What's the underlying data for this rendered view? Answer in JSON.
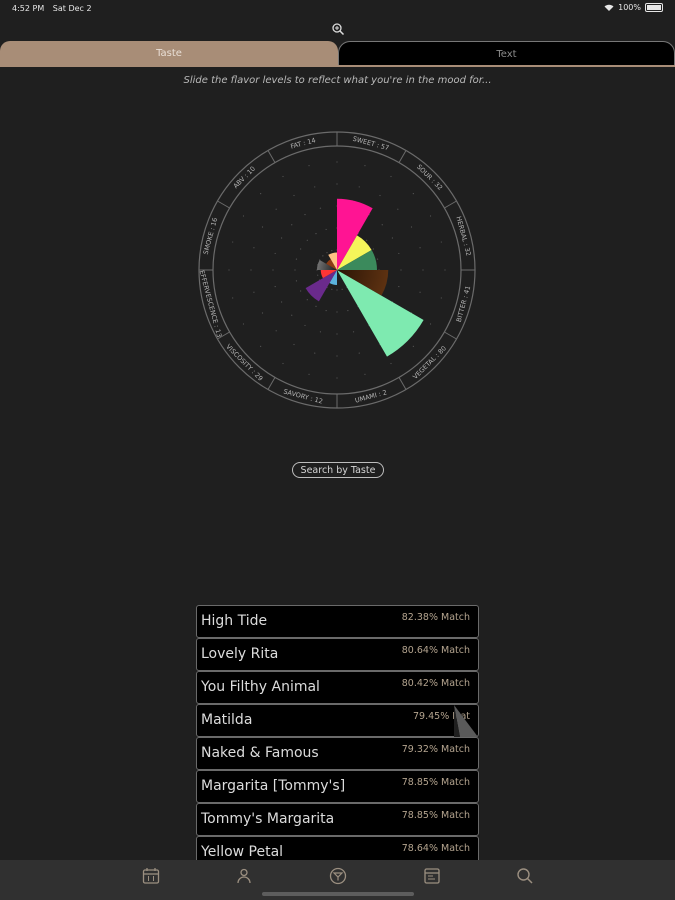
{
  "status_bar": {
    "time": "4:52 PM",
    "date": "Sat Dec 2",
    "battery": "100%"
  },
  "tabs": [
    {
      "label": "Taste",
      "selected": true
    },
    {
      "label": "Text",
      "selected": false
    }
  ],
  "subtitle": "Slide the flavor levels to reflect what you're in the mood for...",
  "wheel_labels": [
    "SWEET : 57",
    "SOUR : 32",
    "HERBAL : 32",
    "BITTER : 41",
    "VEGETAL : 80",
    "UMAMI : 2",
    "SAVORY : 12",
    "VISCOSITY : 29",
    "EFFERVESCENCE : 13",
    "SMOKE : 16",
    "ABV : 10",
    "FAT : 14"
  ],
  "wheel_segments": [
    {
      "name": "sweet",
      "color": "#ff1493",
      "level": 57
    },
    {
      "name": "sour",
      "color": "#f5f55a",
      "level": 32
    },
    {
      "name": "herbal",
      "color": "#3b8a5c",
      "level": 32
    },
    {
      "name": "bitter",
      "color": "#5a3014",
      "level": 41
    },
    {
      "name": "vegetal",
      "color": "#7eeab0",
      "level": 80
    },
    {
      "name": "umami",
      "color": "#2a2a2a",
      "level": 2
    },
    {
      "name": "savory",
      "color": "#5bb3dd",
      "level": 12
    },
    {
      "name": "viscosity",
      "color": "#6a2a8c",
      "level": 29
    },
    {
      "name": "effervescence",
      "color": "#ff3535",
      "level": 13
    },
    {
      "name": "smoke",
      "color": "#bcbcbc",
      "level": 16
    },
    {
      "name": "abv",
      "color": "#8b3a14",
      "level": 10
    },
    {
      "name": "fat",
      "color": "#ffc285",
      "level": 14
    }
  ],
  "search_button": "Search by Taste",
  "results": [
    {
      "name": "High Tide",
      "match": "82.38% Match"
    },
    {
      "name": "Lovely Rita",
      "match": "80.64% Match"
    },
    {
      "name": "You Filthy Animal",
      "match": "80.42% Match"
    },
    {
      "name": "Matilda",
      "match": "79.45% Mat"
    },
    {
      "name": "Naked & Famous",
      "match": "79.32% Match"
    },
    {
      "name": "Margarita [Tommy's]",
      "match": "78.85% Match"
    },
    {
      "name": "Tommy's Margarita",
      "match": "78.85% Match"
    },
    {
      "name": "Yellow Petal",
      "match": "78.64% Match"
    }
  ],
  "nav_items": [
    {
      "icon": "calendar-icon"
    },
    {
      "icon": "person-icon"
    },
    {
      "icon": "cocktail-icon"
    },
    {
      "icon": "document-icon"
    },
    {
      "icon": "search-icon"
    }
  ]
}
